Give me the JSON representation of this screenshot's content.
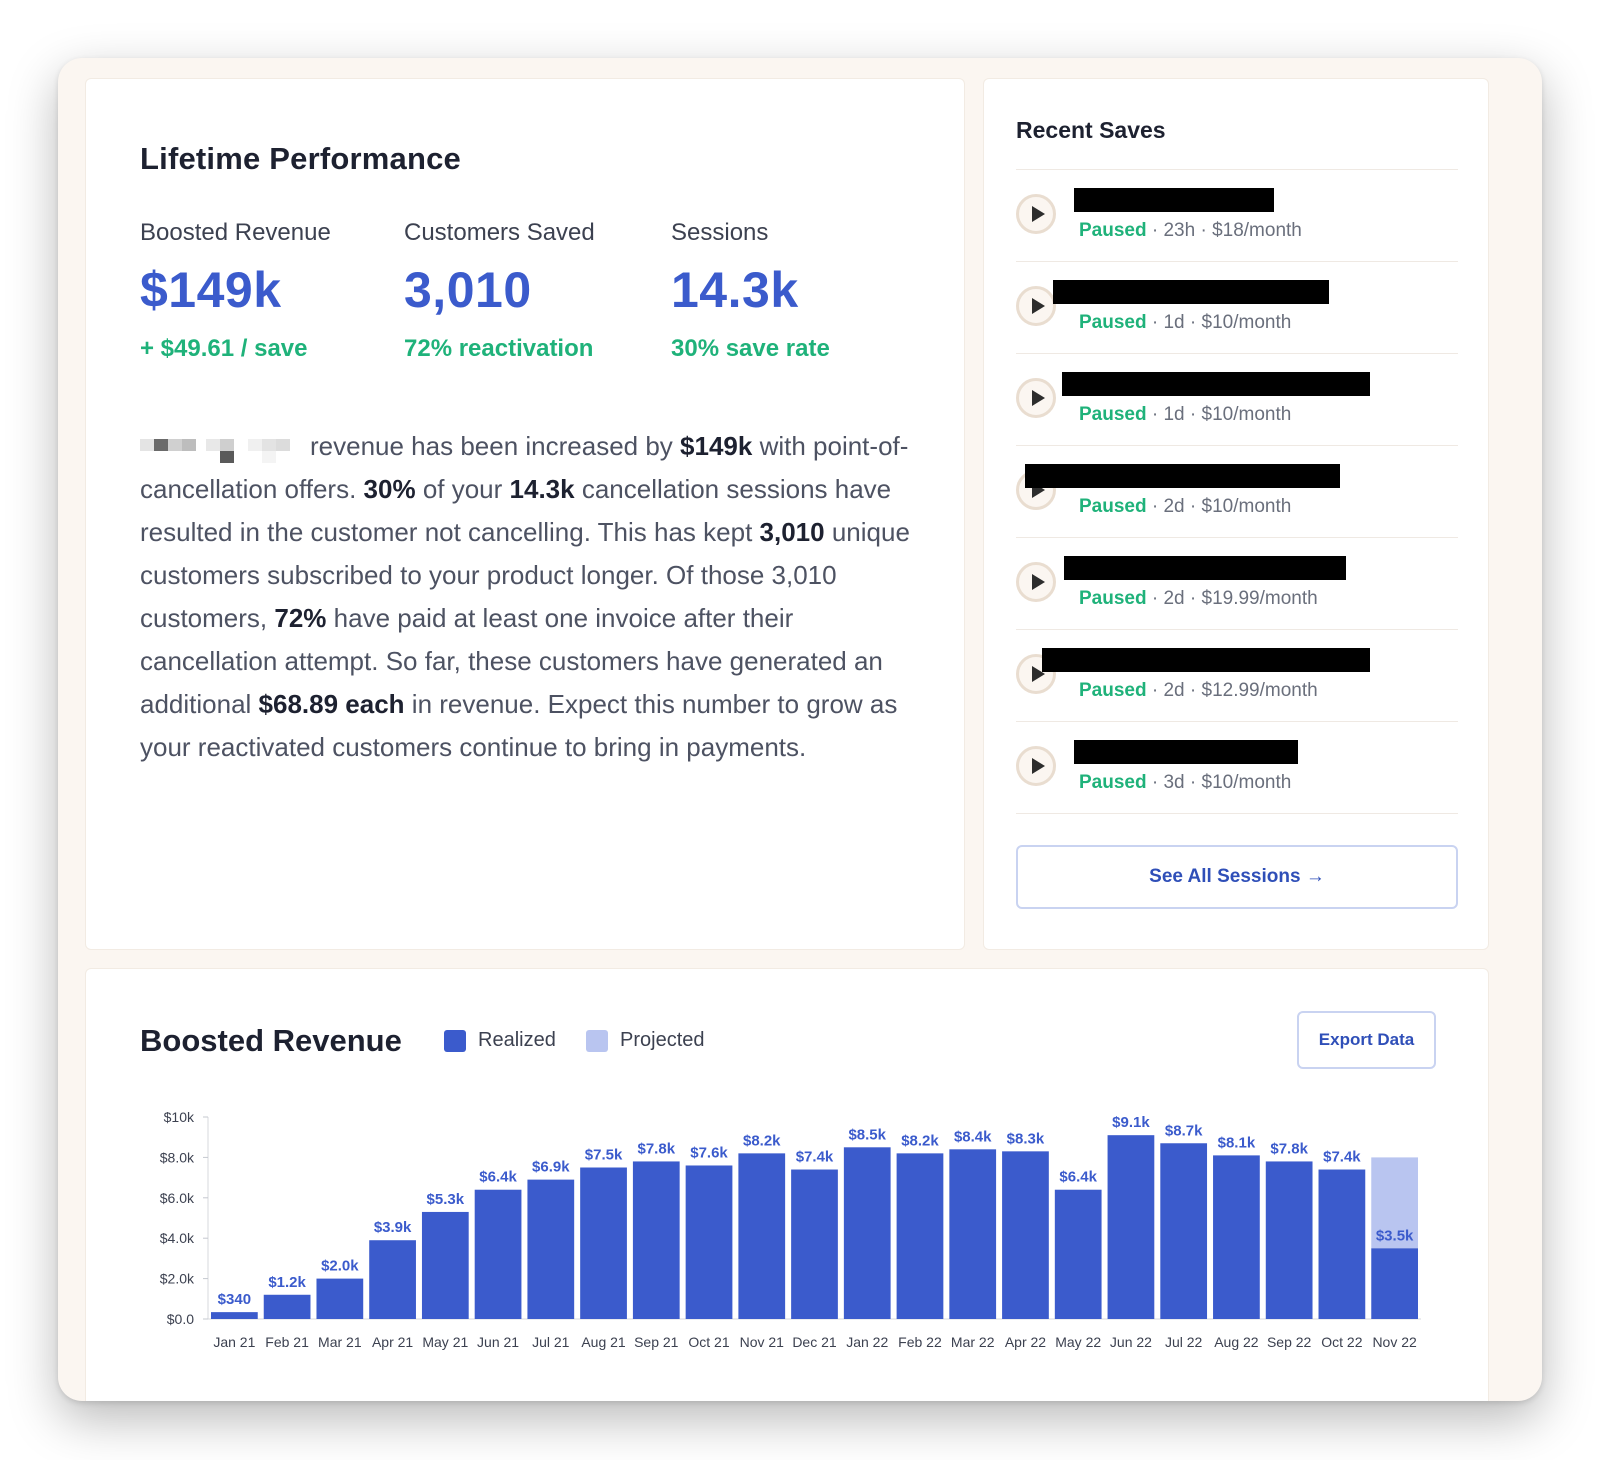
{
  "performance": {
    "title": "Lifetime Performance",
    "metrics": [
      {
        "label": "Boosted Revenue",
        "value": "$149k",
        "sub": "+ $49.61 / save"
      },
      {
        "label": "Customers Saved",
        "value": "3,010",
        "sub": "72% reactivation"
      },
      {
        "label": "Sessions",
        "value": "14.3k",
        "sub": "30% save rate"
      }
    ],
    "paragraph": {
      "t1": "revenue has been increased by ",
      "b1": "$149k",
      "t2": " with point-of-cancellation offers. ",
      "b2": "30%",
      "t3": " of your ",
      "b3": "14.3k",
      "t4": " cancellation sessions have resulted in the customer not cancelling. This has kept ",
      "b4": "3,010",
      "t5": " unique customers subscribed to your product longer. Of those 3,010 customers, ",
      "b5": "72%",
      "t6": " have paid at least one invoice after their cancellation attempt. So far, these customers have generated an additional ",
      "b6": "$68.89 each",
      "t7": " in revenue. Expect this number to grow as your reactivated customers continue to bring in payments."
    }
  },
  "recent": {
    "title": "Recent Saves",
    "items": [
      {
        "status": "Paused",
        "age": "23h",
        "price": "$18/month"
      },
      {
        "status": "Paused",
        "age": "1d",
        "price": "$10/month"
      },
      {
        "status": "Paused",
        "age": "1d",
        "price": "$10/month"
      },
      {
        "status": "Paused",
        "age": "2d",
        "price": "$10/month"
      },
      {
        "status": "Paused",
        "age": "2d",
        "price": "$19.99/month"
      },
      {
        "status": "Paused",
        "age": "2d",
        "price": "$12.99/month"
      },
      {
        "status": "Paused",
        "age": "3d",
        "price": "$10/month"
      }
    ],
    "see_all_label": "See All Sessions →"
  },
  "chart_section": {
    "title": "Boosted Revenue",
    "legend_realized": "Realized",
    "legend_projected": "Projected",
    "export_label": "Export Data"
  },
  "colors": {
    "realized": "#3b5bcc",
    "projected": "#b9c5f0",
    "accent_green": "#1fb27a"
  },
  "chart_data": {
    "type": "bar",
    "title": "Boosted Revenue",
    "categories": [
      "Jan 21",
      "Feb 21",
      "Mar 21",
      "Apr 21",
      "May 21",
      "Jun 21",
      "Jul 21",
      "Aug 21",
      "Sep 21",
      "Oct 21",
      "Nov 21",
      "Dec 21",
      "Jan 22",
      "Feb 22",
      "Mar 22",
      "Apr 22",
      "May 22",
      "Jun 22",
      "Jul 22",
      "Aug 22",
      "Sep 22",
      "Oct 22",
      "Nov 22"
    ],
    "series": [
      {
        "name": "Realized",
        "values": [
          340,
          1200,
          2000,
          3900,
          5300,
          6400,
          6900,
          7500,
          7800,
          7600,
          8200,
          7400,
          8500,
          8200,
          8400,
          8300,
          6400,
          9100,
          8700,
          8100,
          7800,
          7400,
          3500
        ],
        "labels": [
          "$340",
          "$1.2k",
          "$2.0k",
          "$3.9k",
          "$5.3k",
          "$6.4k",
          "$6.9k",
          "$7.5k",
          "$7.8k",
          "$7.6k",
          "$8.2k",
          "$7.4k",
          "$8.5k",
          "$8.2k",
          "$8.4k",
          "$8.3k",
          "$6.4k",
          "$9.1k",
          "$8.7k",
          "$8.1k",
          "$7.8k",
          "$7.4k",
          "$3.5k"
        ]
      },
      {
        "name": "Projected",
        "values": [
          0,
          0,
          0,
          0,
          0,
          0,
          0,
          0,
          0,
          0,
          0,
          0,
          0,
          0,
          0,
          0,
          0,
          0,
          0,
          0,
          0,
          0,
          4500
        ]
      }
    ],
    "ylim": [
      0,
      10000
    ],
    "yticks": [
      0,
      2000,
      4000,
      6000,
      8000,
      10000
    ],
    "ytick_labels": [
      "$0.0",
      "$2.0k",
      "$4.0k",
      "$6.0k",
      "$8.0k",
      "$10k"
    ],
    "legend": "top-left"
  }
}
